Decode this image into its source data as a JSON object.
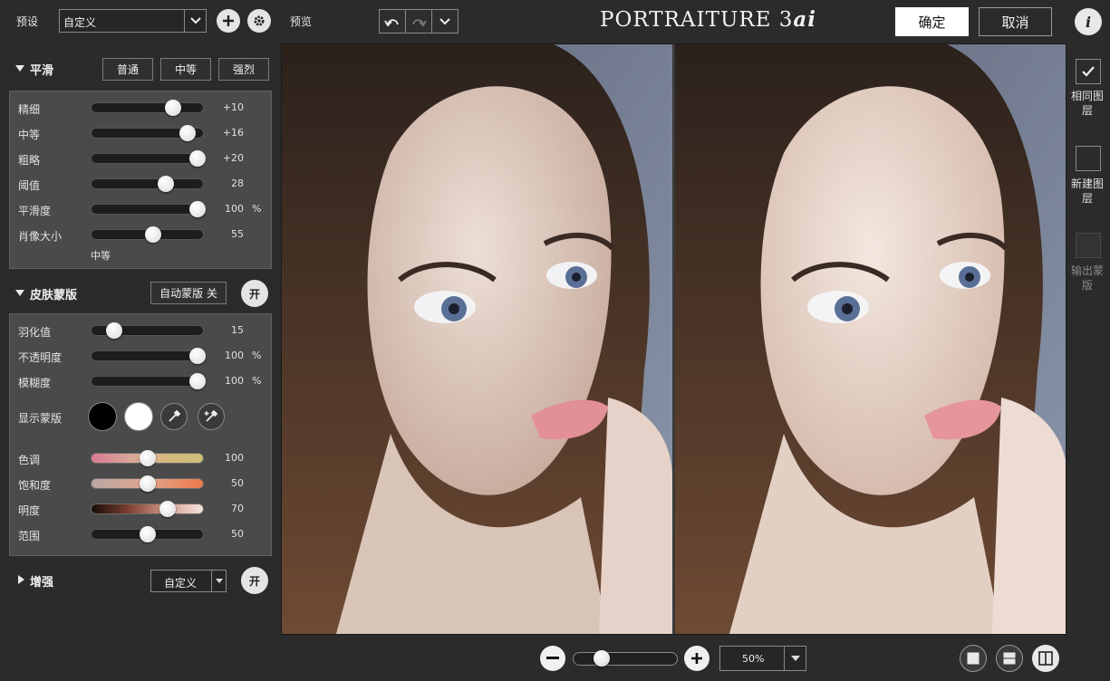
{
  "preset": {
    "label": "预设",
    "value": "自定义"
  },
  "preview_label": "预览",
  "brand": {
    "main": "PORTRAITURE 3",
    "suffix": "ai"
  },
  "actions": {
    "ok": "确定",
    "cancel": "取消",
    "info": "i"
  },
  "smoothing": {
    "title": "平滑",
    "presets": [
      "普通",
      "中等",
      "强烈"
    ],
    "sliders": [
      {
        "label": "精细",
        "value": "+10",
        "unit": "",
        "level": 0.73
      },
      {
        "label": "中等",
        "value": "+16",
        "unit": "",
        "level": 0.86
      },
      {
        "label": "粗略",
        "value": "+20",
        "unit": "",
        "level": 0.95
      },
      {
        "label": "阈值",
        "value": "28",
        "unit": "",
        "level": 0.67
      },
      {
        "label": "平滑度",
        "value": "100",
        "unit": "%",
        "level": 0.95
      },
      {
        "label": "肖像大小",
        "value": "55",
        "unit": "",
        "level": 0.55
      }
    ],
    "portrait_size_caption": "中等"
  },
  "skin_mask": {
    "title": "皮肤蒙版",
    "auto_button": "自动蒙版 关",
    "toggle": "开",
    "sliders": [
      {
        "label": "羽化值",
        "value": "15",
        "unit": "",
        "level": 0.2
      },
      {
        "label": "不透明度",
        "value": "100",
        "unit": "%",
        "level": 0.95
      },
      {
        "label": "模糊度",
        "value": "100",
        "unit": "%",
        "level": 0.95
      }
    ],
    "show_mask_label": "显示蒙版",
    "color_sliders": [
      {
        "label": "色调",
        "value": "100",
        "level": 0.5
      },
      {
        "label": "饱和度",
        "value": "50",
        "level": 0.5
      },
      {
        "label": "明度",
        "value": "70",
        "level": 0.68
      },
      {
        "label": "范围",
        "value": "50",
        "level": 0.5
      }
    ]
  },
  "enhance": {
    "title": "增强",
    "preset": "自定义",
    "toggle": "开"
  },
  "right_panel": {
    "same_layer": "相同图层",
    "new_layer": "新建图层",
    "output_mask": "输出蒙版"
  },
  "zoom": {
    "value": "50%",
    "level": 0.27
  }
}
